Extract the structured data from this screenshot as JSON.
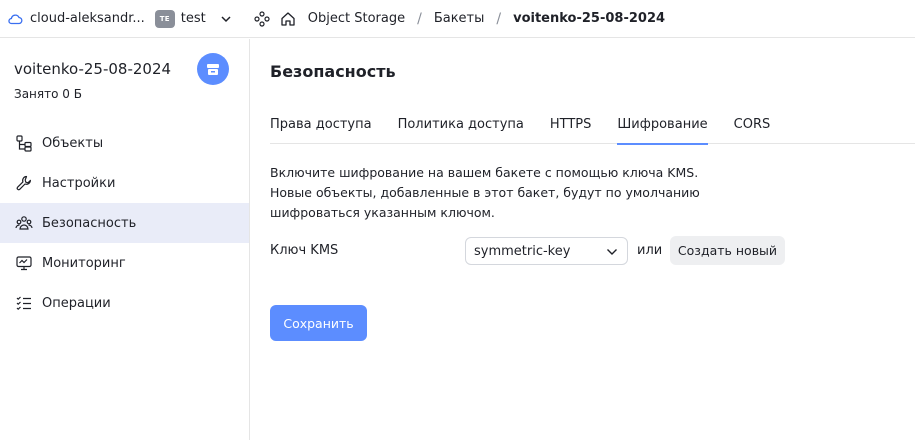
{
  "header": {
    "cloud_name": "cloud-aleksandr...",
    "folder_badge": "TE",
    "folder_name": "test",
    "breadcrumbs": [
      "Object Storage",
      "Бакеты",
      "voitenko-25-08-2024"
    ],
    "separator": "/"
  },
  "sidebar": {
    "bucket_name": "voitenko-25-08-2024",
    "bucket_used": "Занято 0 Б",
    "items": [
      {
        "label": "Объекты",
        "icon": "objects-icon"
      },
      {
        "label": "Настройки",
        "icon": "wrench-icon"
      },
      {
        "label": "Безопасность",
        "icon": "users-icon"
      },
      {
        "label": "Мониторинг",
        "icon": "monitor-icon"
      },
      {
        "label": "Операции",
        "icon": "list-check-icon"
      }
    ],
    "active_index": 2
  },
  "main": {
    "title": "Безопасность",
    "tabs": [
      "Права доступа",
      "Политика доступа",
      "HTTPS",
      "Шифрование",
      "CORS"
    ],
    "active_tab": 3,
    "description": "Включите шифрование на вашем бакете с помощью ключа KMS. Новые объекты, добавленные в этот бакет, будут по умолчанию шифроваться указанным ключом.",
    "kms_label": "Ключ KMS",
    "kms_value": "symmetric-key",
    "or_text": "или",
    "create_label": "Создать новый",
    "save_label": "Сохранить"
  },
  "colors": {
    "accent": "#5c8dff",
    "active_nav_bg": "#e9ecf8"
  }
}
